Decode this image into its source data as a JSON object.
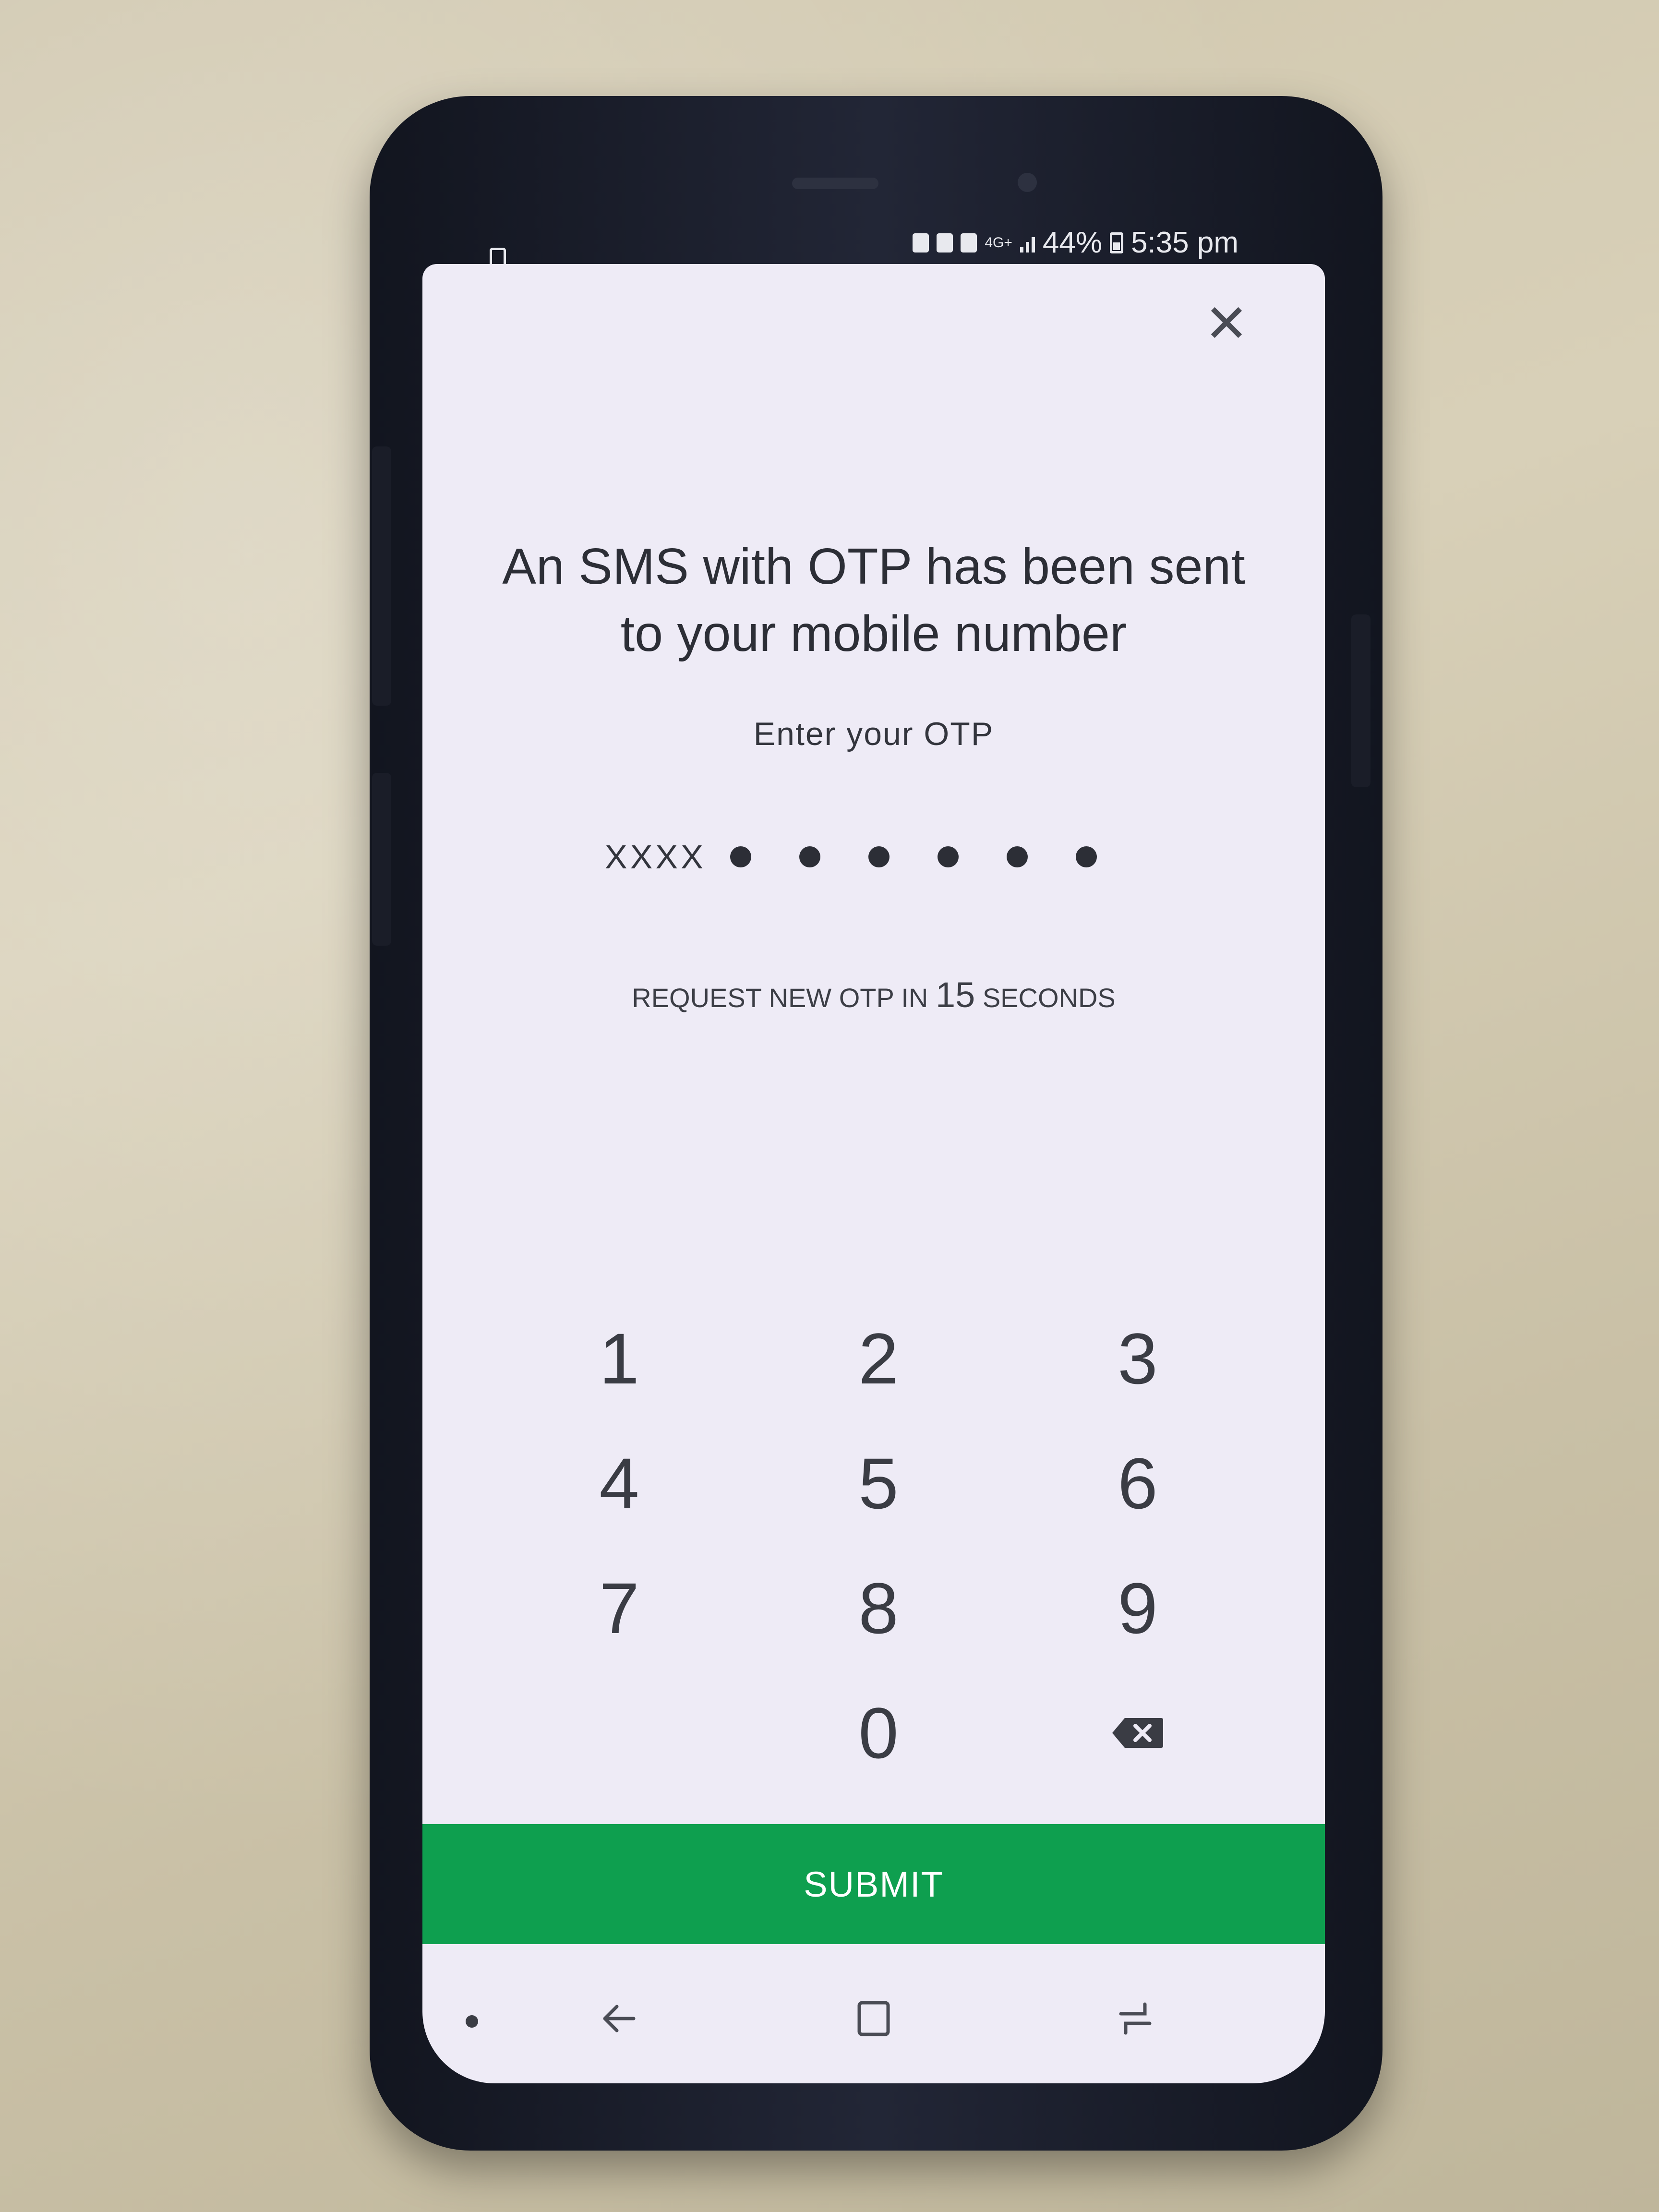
{
  "status_bar": {
    "network": "4G+",
    "battery": "44%",
    "time": "5:35 pm"
  },
  "dialog": {
    "headline_line1": "An SMS with OTP has been sent",
    "headline_line2": "to your mobile number",
    "subtitle": "Enter your OTP",
    "otp_prefix": "XXXX",
    "otp_masked_digits": 6,
    "timer_prefix": "REQUEST NEW OTP IN",
    "timer_seconds": "15",
    "timer_suffix": "SECONDS"
  },
  "keypad": {
    "keys": [
      "1",
      "2",
      "3",
      "4",
      "5",
      "6",
      "7",
      "8",
      "9",
      "",
      "0",
      "backspace-icon"
    ]
  },
  "submit_label": "SUBMIT",
  "colors": {
    "accent": "#0e9f4f",
    "screen_bg": "#eeebf6",
    "text": "#2c2e36"
  },
  "icons": [
    "close-icon",
    "backspace-icon",
    "back-icon",
    "home-icon",
    "recents-icon"
  ]
}
